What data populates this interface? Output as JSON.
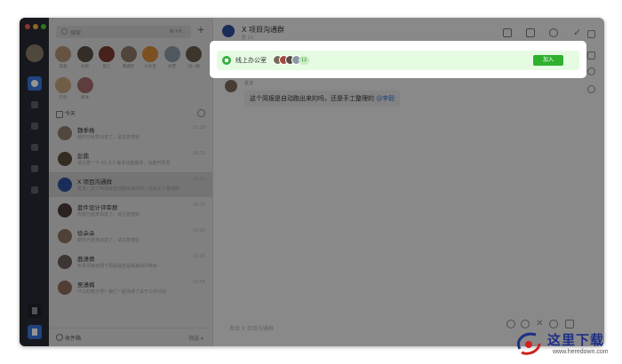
{
  "search": {
    "placeholder": "搜索",
    "shortcut": "⌘+K"
  },
  "contacts": [
    {
      "name": "前盖",
      "color": "#b29070"
    },
    {
      "name": "文尚",
      "color": "#5a4e44"
    },
    {
      "name": "星乙",
      "color": "#7a3a30"
    },
    {
      "name": "黄姿钦",
      "color": "#8a7666"
    },
    {
      "name": "小文宝",
      "color": "#d88a3a"
    },
    {
      "name": "文雯",
      "color": "#8a98a6"
    },
    {
      "name": "刘一晚",
      "color": "#6a5a4a"
    },
    {
      "name": "叮伦",
      "color": "#c0a07a"
    },
    {
      "name": "郑冰",
      "color": "#a06a6a"
    }
  ],
  "list_header": {
    "today": "今天"
  },
  "conversations": [
    {
      "title": "魏季杨",
      "preview": "邮件已经发出去了，请注意查收",
      "time": "21:20",
      "color": "#8c7a6a",
      "selected": false
    },
    {
      "title": "彭鼎",
      "preview": "请注意一下 V1.3.2 版本功能需求，功能可否发",
      "time": "16:23",
      "color": "#5a4a3a",
      "selected": false
    },
    {
      "title": "X 项目沟通群",
      "preview": "夏凌：这个简报是自动跑出来的吗，还是手工整理的",
      "time": "16:20",
      "color": "#2d4f9a",
      "selected": true
    },
    {
      "title": "套件设计评审群",
      "preview": "周俊已经发出去了，请注意查收",
      "time": "14:13",
      "color": "#4a3a3a",
      "selected": false
    },
    {
      "title": "徐朵朵",
      "preview": "邮件已经发出去了，请注意查收",
      "time": "14:02",
      "color": "#8a7060",
      "selected": false
    },
    {
      "title": "鹿潇倩",
      "preview": "农事项目双周下周是我还是我来出评审会",
      "time": "11:35",
      "color": "#6a5a5a",
      "selected": false
    },
    {
      "title": "吴潇楠",
      "preview": "什么时候方便？我们一起沟通下关于工作计划",
      "time": "10:58",
      "color": "#8a6a5a",
      "selected": false
    }
  ],
  "archive": {
    "label": "收件箱",
    "filter": "筛选 ▾"
  },
  "chat": {
    "title": "X 项目沟通群",
    "subtitle": "群 23",
    "message": {
      "sender": "夏凌",
      "text": "这个简报是自动跑出来的吗，还是手工整理的",
      "link": "@李毅"
    },
    "input_placeholder": "发给 X 项目沟通群"
  },
  "banner": {
    "title": "线上办公室",
    "member_count": "12",
    "join_label": "加入"
  },
  "watermark": {
    "site": "这里下载",
    "url": "www.heredown.com"
  }
}
